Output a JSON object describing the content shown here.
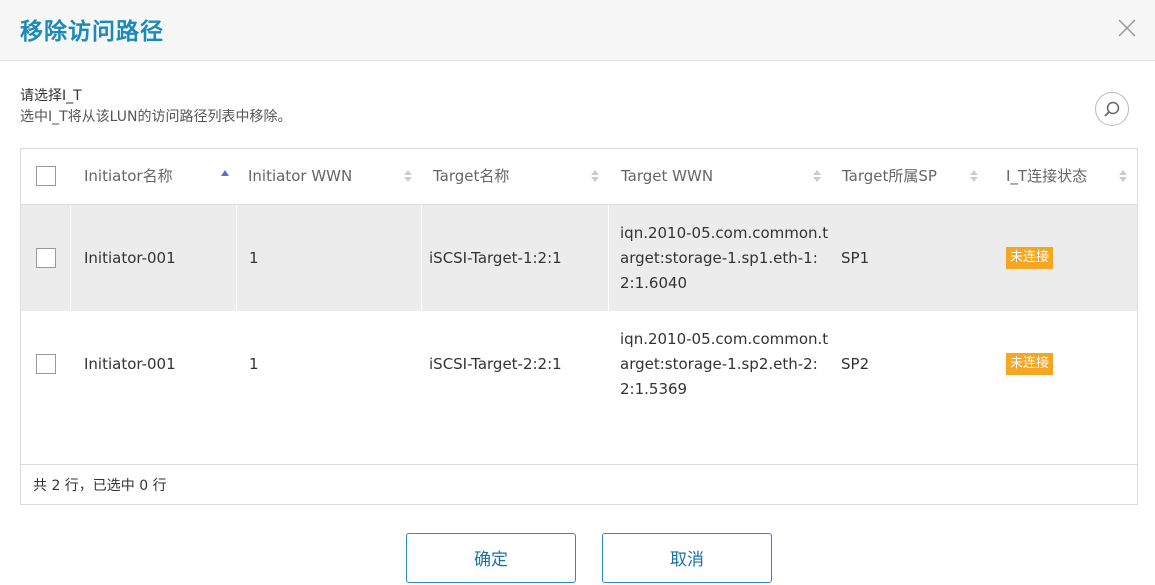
{
  "dialog": {
    "title": "移除访问路径",
    "subtitle": "请选择I_T",
    "description": "选中I_T将从该LUN的访问路径列表中移除。"
  },
  "table": {
    "columns": [
      {
        "label": "Initiator名称",
        "sort": "asc"
      },
      {
        "label": "Initiator WWN",
        "sort": "none"
      },
      {
        "label": "Target名称",
        "sort": "none"
      },
      {
        "label": "Target WWN",
        "sort": "none"
      },
      {
        "label": "Target所属SP",
        "sort": "none"
      },
      {
        "label": "I_T连接状态",
        "sort": "none"
      }
    ],
    "rows": [
      {
        "initiator_name": "Initiator-001",
        "initiator_wwn": "1",
        "target_name": "iSCSI-Target-1:2:1",
        "target_wwn": "iqn.2010-05.com.common.target:storage-1.sp1.eth-1:2:1.6040",
        "target_sp": "SP1",
        "status": "未连接",
        "checked": false
      },
      {
        "initiator_name": "Initiator-001",
        "initiator_wwn": "1",
        "target_name": "iSCSI-Target-2:2:1",
        "target_wwn": "iqn.2010-05.com.common.target:storage-1.sp2.eth-2:2:1.5369",
        "target_sp": "SP2",
        "status": "未连接",
        "checked": false
      }
    ],
    "footer": "共 2 行，已选中 0 行"
  },
  "buttons": {
    "confirm": "确定",
    "cancel": "取消"
  },
  "colors": {
    "title": "#1a8bb8",
    "status_badge": "#f5a623",
    "button_border": "#2e8bc0"
  },
  "icons": {
    "close": "close-icon",
    "search": "search-icon",
    "sort": "sort-icon"
  }
}
